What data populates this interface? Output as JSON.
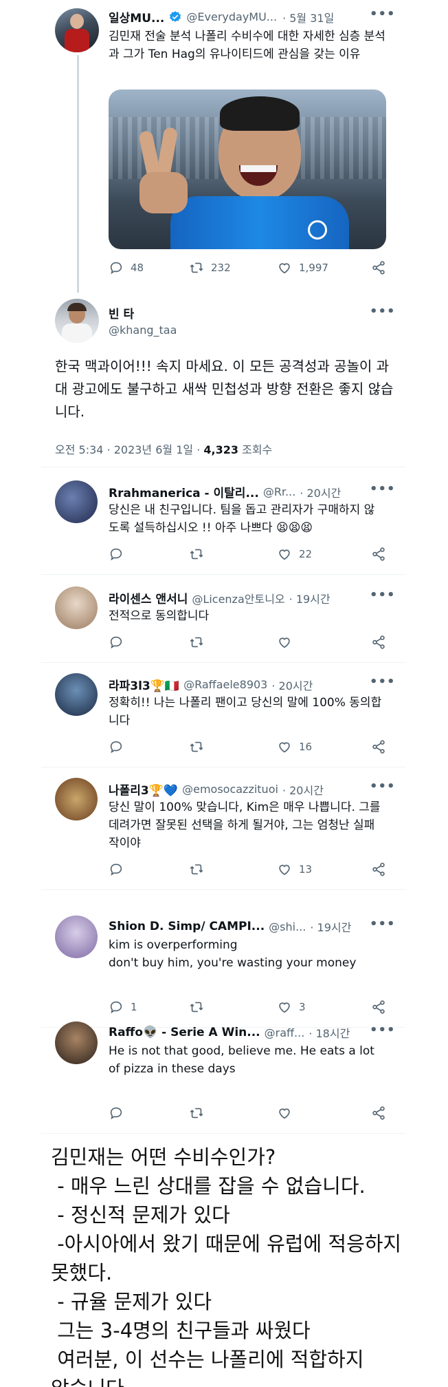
{
  "tweet1": {
    "name": "일상MU...",
    "handle": "@EverydayMU...",
    "date": "· 5월 31일",
    "text": "김민재 전술 분석 나폴리 수비수에 대한 자세한 심층 분석과 그가 Ten Hag의 유나이티드에 관심을 갖는 이유",
    "replies": "48",
    "retweets": "232",
    "likes": "1,997"
  },
  "tweet2": {
    "name": "빈 타",
    "handle": "@khang_taa",
    "text": "한국 맥과이어!!! 속지 마세요. 이 모든 공격성과 공놀이 과대 광고에도 불구하고 새싹 민첩성과 방향 전환은 좋지 않습니다.",
    "meta_time": "오전 5:34 · 2023년 6월 1일 · ",
    "views_count": "4,323",
    "views_label": "조회수"
  },
  "replies": [
    {
      "name": "Rrahmanerica - 이탈리...",
      "handle": "@Rr...",
      "time": "· 20시간",
      "text": "당신은 내 친구입니다. 팀을 돕고 관리자가 구매하지 않도록 설득하십시오 !! 아주 나쁘다 😫😫😫",
      "reply_count": "",
      "retweet_count": "",
      "like_count": "22"
    },
    {
      "name": "라이센스 앤서니",
      "handle": "@Licenza안토니오",
      "time": "· 19시간",
      "text": "전적으로 동의합니다",
      "reply_count": "",
      "retweet_count": "",
      "like_count": ""
    },
    {
      "name": "라파3l3🏆🇮🇹",
      "handle": "@Raffaele8903",
      "time": "· 20시간",
      "text": "정확히!! 나는 나폴리 팬이고 당신의 말에 100% 동의합니다",
      "reply_count": "",
      "retweet_count": "",
      "like_count": "16"
    },
    {
      "name": "나폴리3🏆💙",
      "handle": "@emosocazzituoi",
      "time": "· 20시간",
      "text": "당신 말이 100% 맞습니다, Kim은 매우 나쁩니다. 그를 데려가면 잘못된 선택을 하게 될거야, 그는 엄청난 실패작이야",
      "reply_count": "",
      "retweet_count": "",
      "like_count": "13"
    },
    {
      "name": "Shion D. Simp/ CAMPI...",
      "handle": "@shi...",
      "time": "· 19시간",
      "text": "kim is overperforming\ndon't buy him, you're wasting your money",
      "reply_count": "1",
      "retweet_count": "",
      "like_count": "3"
    },
    {
      "name": "Raffo👽 - Serie A Win...",
      "handle": "@raff...",
      "time": "· 18시간",
      "text": "He is not that good, believe me. He eats a lot of pizza in these days",
      "reply_count": "",
      "retweet_count": "",
      "like_count": ""
    }
  ],
  "caption": {
    "title": "김민재는 어떤 수비수인가?",
    "line1": " - 매우 느린 상대를 잡을 수 없습니다.",
    "line2": " - 정신적 문제가 있다",
    "line3": " -아시아에서 왔기 때문에 유럽에 적응하지",
    "line4": "못했다.",
    "line5": " - 규율 문제가 있다",
    "line6": " 그는 3-4명의 친구들과 싸웠다",
    "line7": " 여러분, 이 선수는 나폴리에 적합하지",
    "line8": "않습니다."
  },
  "icons": {
    "verified_color": "#1d9bf0",
    "reply": "reply-icon",
    "retweet": "retweet-icon",
    "like": "heart-icon",
    "share": "share-icon",
    "more": "more-icon"
  }
}
